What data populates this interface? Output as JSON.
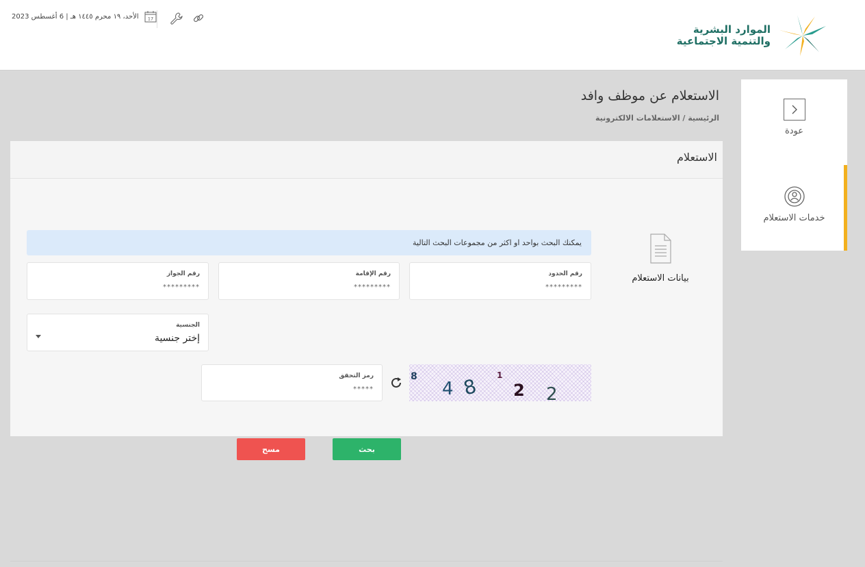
{
  "header": {
    "date_text": "الأحد، ١٩ محرم ١٤٤٥ هـ | 6 أغسطس 2023",
    "calendar_day": "17",
    "logo_line1": "الموارد البشرية",
    "logo_line2": "والتنمية الاجتماعية"
  },
  "sidebar": {
    "items": [
      {
        "label": "عودة",
        "icon": "chevron-right-icon"
      },
      {
        "label": "خدمات الاستعلام",
        "icon": "inquiry-services-icon"
      }
    ]
  },
  "page": {
    "title": "الاستعلام عن موظف وافد",
    "breadcrumb": "الرئيسية / الاستعلامات الالكترونية"
  },
  "panel": {
    "title": "الاستعلام",
    "section_label": "بيانات الاستعلام",
    "info_text": "يمكنك البحث بواحد او اكثر من مجموعات البحث التالية",
    "fields": {
      "border_number": {
        "label": "رقم الحدود",
        "value": "*********"
      },
      "iqama_number": {
        "label": "رقم الإقامة",
        "value": "*********"
      },
      "passport_number": {
        "label": "رقم الجواز",
        "value": "*********"
      },
      "nationality": {
        "label": "الجنسية",
        "value": "إختر جنسية"
      },
      "captcha": {
        "label": "رمز التحقق",
        "value": "*****"
      }
    },
    "captcha_chars": [
      "8",
      "4",
      "8",
      "1",
      "2",
      "2"
    ],
    "buttons": {
      "search": "بحث",
      "clear": "مسح"
    }
  },
  "colors": {
    "accent_yellow": "#f2b01e",
    "search_green": "#2db36a",
    "clear_red": "#ef5350",
    "brand_teal": "#1f6f64",
    "info_blue": "#dbeafa"
  }
}
